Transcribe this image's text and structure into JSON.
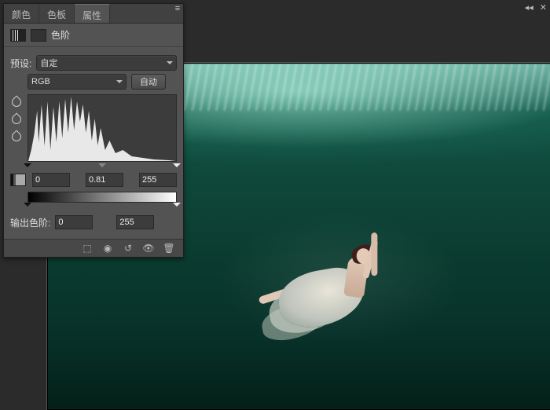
{
  "tabs": {
    "color": "颜色",
    "swatches": "色板",
    "properties": "属性"
  },
  "adjustment": {
    "title": "色阶"
  },
  "preset": {
    "label": "预设:",
    "value": "自定"
  },
  "channel": {
    "value": "RGB"
  },
  "autoBtn": "自动",
  "inputLevels": {
    "black": "0",
    "gamma": "0.81",
    "white": "255"
  },
  "output": {
    "label": "输出色阶:",
    "black": "0",
    "white": "255"
  },
  "controls": {
    "collapse": "◂◂",
    "close": "✕"
  },
  "footerIcons": {
    "clip": "⬚",
    "view": "◉",
    "reset": "↺",
    "visible": "👁",
    "trash": "🗑"
  }
}
